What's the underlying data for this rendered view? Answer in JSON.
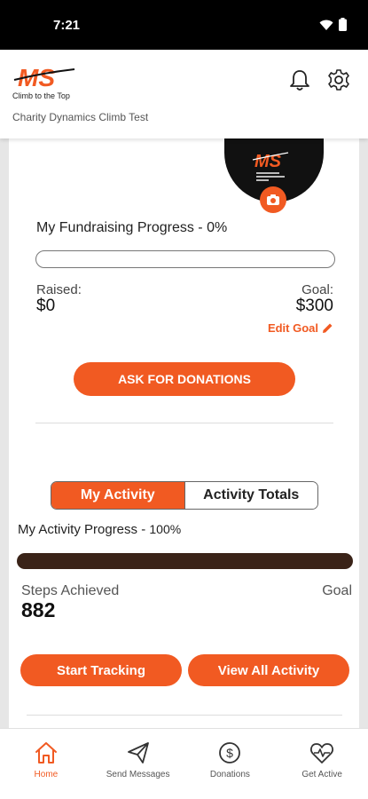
{
  "status": {
    "time": "7:21"
  },
  "header": {
    "logo_text": "MS",
    "logo_tagline": "Climb to the Top",
    "campaign_name": "Charity Dynamics Climb Test"
  },
  "fundraising": {
    "title": "My Fundraising Progress - 0%",
    "progress_fraction": 0,
    "raised_label": "Raised:",
    "raised_value": "$0",
    "goal_label": "Goal:",
    "goal_value": "$300",
    "edit_goal": "Edit Goal",
    "ask_button": "ASK FOR DONATIONS"
  },
  "activity": {
    "tabs": [
      {
        "label": "My Activity",
        "active": true
      },
      {
        "label": "Activity Totals",
        "active": false
      }
    ],
    "progress_title": "My Activity Progress -",
    "progress_pct": "100%",
    "progress_fraction": 1,
    "steps_label": "Steps Achieved",
    "steps_value": "882",
    "goal_label": "Goal",
    "start_button": "Start Tracking",
    "view_button": "View All Activity"
  },
  "nav": {
    "items": [
      {
        "label": "Home",
        "icon": "home-icon",
        "active": true
      },
      {
        "label": "Send Messages",
        "icon": "paper-plane-icon",
        "active": false
      },
      {
        "label": "Donations",
        "icon": "dollar-circle-icon",
        "active": false
      },
      {
        "label": "Get Active",
        "icon": "heart-pulse-icon",
        "active": false
      }
    ]
  },
  "colors": {
    "accent": "#f15a22",
    "activity_fill": "#3a2318"
  }
}
